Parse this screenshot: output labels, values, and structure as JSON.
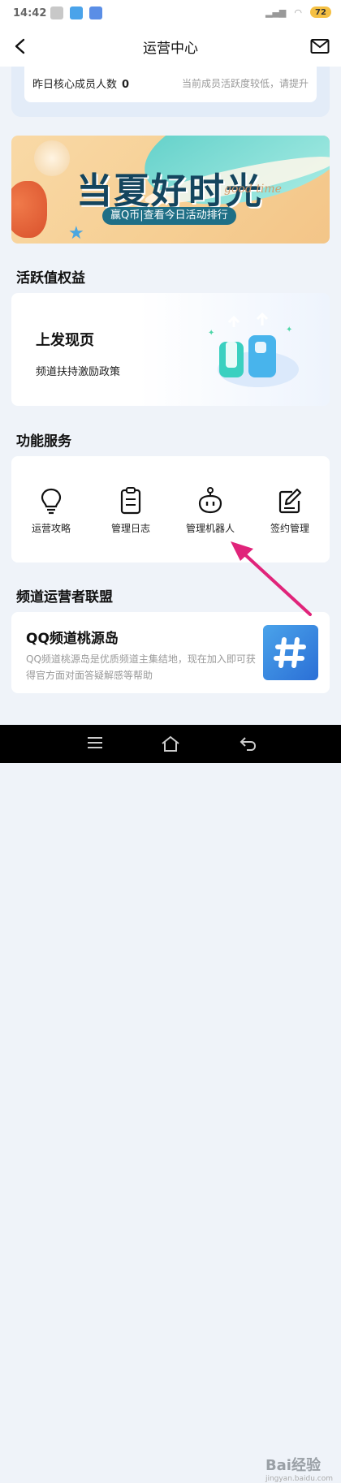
{
  "status_bar": {
    "time": "14:42",
    "battery": "72"
  },
  "nav": {
    "title": "运营中心"
  },
  "top_card": {
    "label": "昨日核心成员人数",
    "value": "0",
    "hint": "当前成员活跃度较低，请提升"
  },
  "banner": {
    "headline": "当夏好时光",
    "subtitle": "赢Q币|查看今日活动排行",
    "script": "good time"
  },
  "activity": {
    "section_title": "活跃值权益",
    "card_title": "上发现页",
    "card_desc": "频道扶持激励政策"
  },
  "services": {
    "section_title": "功能服务",
    "items": [
      {
        "label": "运营攻略",
        "icon": "lightbulb-icon"
      },
      {
        "label": "管理日志",
        "icon": "clipboard-icon"
      },
      {
        "label": "管理机器人",
        "icon": "robot-icon"
      },
      {
        "label": "签约管理",
        "icon": "edit-icon"
      }
    ]
  },
  "alliance": {
    "section_title": "频道运营者联盟",
    "card_title": "QQ频道桃源岛",
    "card_desc": "QQ频道桃源岛是优质频道主集结地，现在加入即可获得官方面对面答疑解感等帮助"
  },
  "watermark": {
    "text": "Bai经验",
    "sub": "jingyan.baidu.com"
  },
  "colors": {
    "accent_arrow": "#e0247a",
    "brand_blue": "#2b6fd6",
    "background": "#eff3f9"
  }
}
